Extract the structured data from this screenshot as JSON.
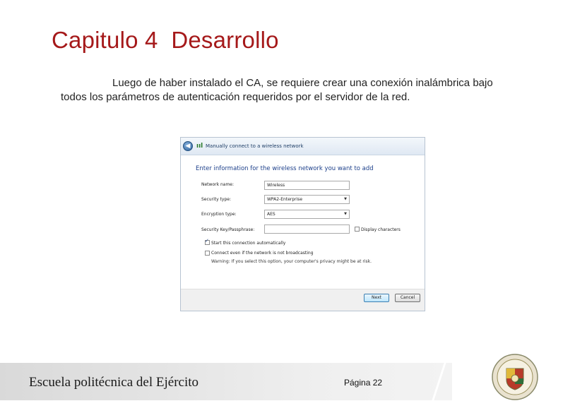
{
  "slide": {
    "title": "Capitulo 4  Desarrollo",
    "paragraph": "Luego de haber instalado el CA, se requiere crear una conexión inalámbrica bajo todos los parámetros de autenticación requeridos por el servidor de la red."
  },
  "dialog": {
    "title": "Manually connect to a wireless network",
    "heading": "Enter information for the wireless network you want to add",
    "fields": {
      "network_name": {
        "label": "Network name:",
        "value": "Wireless"
      },
      "security_type": {
        "label": "Security type:",
        "value": "WPA2-Enterprise"
      },
      "encryption_type": {
        "label": "Encryption type:",
        "value": "AES"
      },
      "security_key": {
        "label": "Security Key/Passphrase:",
        "value": ""
      }
    },
    "display_characters_label": "Display characters",
    "start_auto_label": "Start this connection automatically",
    "connect_even_label": "Connect even if the network is not broadcasting",
    "warning": "Warning: If you select this option, your computer's privacy might be at risk.",
    "next_label": "Next",
    "cancel_label": "Cancel",
    "start_auto_checked": true,
    "connect_even_checked": false,
    "display_characters_checked": false
  },
  "footer": {
    "school": "Escuela politécnica del Ejército",
    "page": "Página 22"
  },
  "colors": {
    "title": "#a5191a",
    "dialog_heading": "#1c3f8a"
  }
}
